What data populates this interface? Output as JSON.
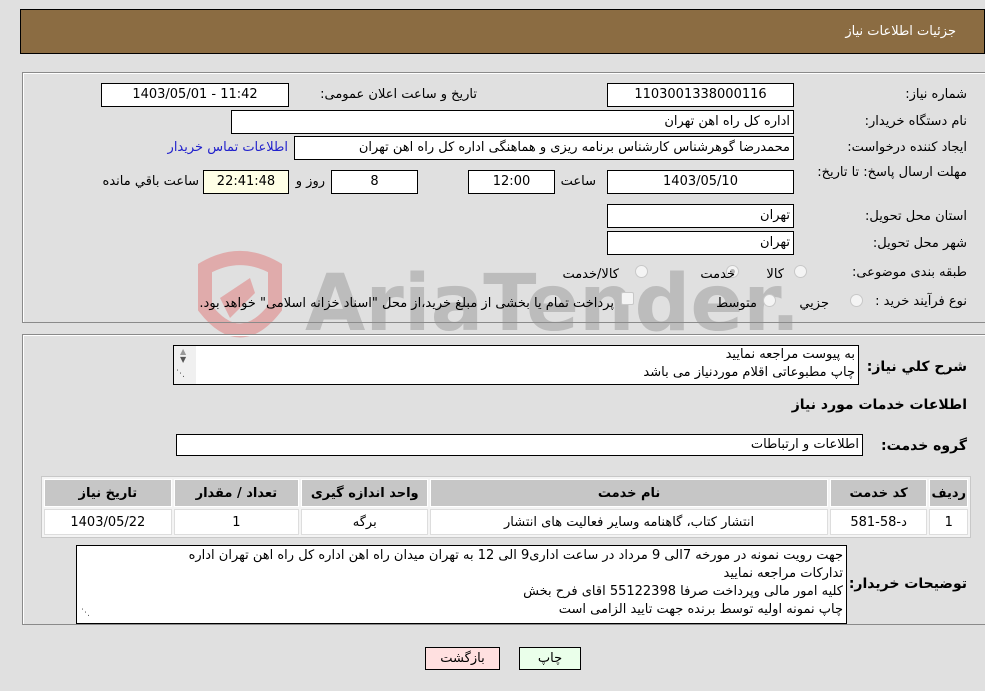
{
  "header": {
    "title": "جزئیات اطلاعات نیاز"
  },
  "form": {
    "need_number": {
      "label": "شماره نیاز:",
      "value": "1103001338000116"
    },
    "announce_datetime": {
      "label": "تاریخ و ساعت اعلان عمومی:",
      "value": "1403/05/01 - 11:42"
    },
    "buyer_org": {
      "label": "نام دستگاه خریدار:",
      "value": "اداره کل راه اهن تهران"
    },
    "requester": {
      "label": "ایجاد کننده درخواست:",
      "value": "محمدرضا گوهرشناس کارشناس برنامه ریزی و هماهنگی اداره کل راه اهن تهران",
      "contact_link": "اطلاعات تماس خریدار"
    },
    "deadline": {
      "label": "مهلت ارسال پاسخ: تا تاریخ:",
      "date": "1403/05/10",
      "time_label": "ساعت",
      "time": "12:00",
      "days": "8",
      "days_label": "روز و",
      "remaining": "22:41:48",
      "remaining_label": "ساعت باقي مانده"
    },
    "province": {
      "label": "استان محل تحویل:",
      "value": "تهران"
    },
    "city": {
      "label": "شهر محل تحویل:",
      "value": "تهران"
    },
    "category": {
      "label": "طبقه بندی موضوعی:",
      "options": [
        "کالا",
        "خدمت",
        "کالا/خدمت"
      ],
      "selected": "خدمت"
    },
    "purchase_type": {
      "label": "نوع فرآیند خرید :",
      "options": [
        "جزيي",
        "متوسط"
      ],
      "treasury_note": "پرداخت تمام یا بخشی از مبلغ خرید،از محل \"اسناد خزانه اسلامی\" خواهد بود."
    }
  },
  "details": {
    "description_label": "شرح كلي نياز:",
    "description_lines": [
      "به پیوست مراجعه نمایید",
      "چاپ مطبوعاتی اقلام موردنیاز می باشد"
    ],
    "services_heading": "اطلاعات خدمات مورد نياز",
    "service_group_label": "گروه خدمت:",
    "service_group_value": "اطلاعات و ارتباطات",
    "table": {
      "headers": [
        "رديف",
        "كد خدمت",
        "نام خدمت",
        "واحد اندازه گيری",
        "تعداد / مقدار",
        "تاريخ نياز"
      ],
      "rows": [
        [
          "1",
          "د-58-581",
          "انتشار کتاب، گاهنامه وسایر فعالیت های انتشار",
          "برگه",
          "1",
          "1403/05/22"
        ]
      ]
    },
    "buyer_notes_label": "توضيحات خريدار:",
    "buyer_notes_lines": [
      "جهت رویت نمونه در مورخه 7الی 9 مرداد در ساعت اداری9 الی 12  به تهران میدان راه اهن  اداره کل راه اهن تهران اداره",
      "تدارکات مراجعه نمایید",
      "کلیه امور مالی وپرداخت صرفا 55122398 اقای فرح بخش",
      "چاپ نمونه اولیه توسط برنده جهت تایید الزامی است"
    ]
  },
  "buttons": {
    "print": "چاپ",
    "back": "بازگشت"
  },
  "watermark": {
    "text": "AriaTender.neT"
  },
  "colors": {
    "header_bg": "#8b6c42",
    "print_bg": "#eaffea",
    "back_bg": "#ffe0e0",
    "link": "#2222cc"
  }
}
